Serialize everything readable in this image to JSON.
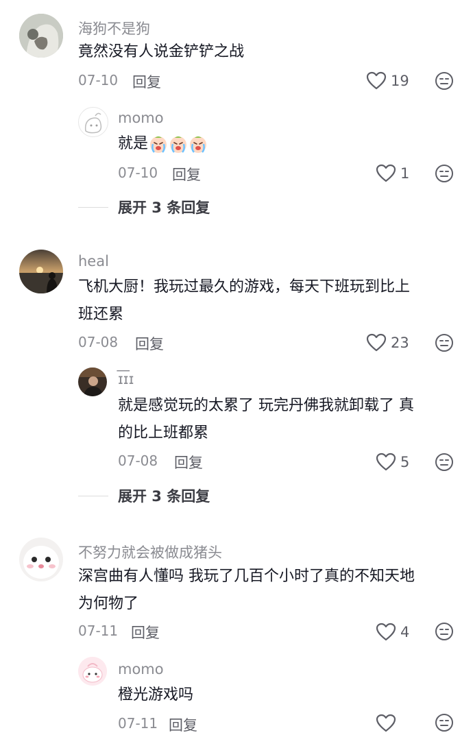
{
  "comments": [
    {
      "name": "海狗不是狗",
      "text_lines": [
        "竟然没有人说金铲铲之战"
      ],
      "date": "07-10",
      "reply_label": "回复",
      "likes": "19",
      "replies": [
        {
          "name": "momo",
          "text_lines": [
            "就是"
          ],
          "emojis": [
            "crying-face",
            "crying-face",
            "crying-face"
          ],
          "date": "07-10",
          "reply_label": "回复",
          "likes": "1"
        }
      ],
      "expand_label": "展开 3 条回复"
    },
    {
      "name": "heal",
      "text_lines": [
        "飞机大厨！我玩过最久的游戏，每天下班玩到比上",
        "班还累"
      ],
      "date": "07-08",
      "reply_label": "回复",
      "likes": "23",
      "replies": [
        {
          "name": "ɪ͞ɪɪ",
          "text_lines": [
            "就是感觉玩的太累了 玩完丹佛我就卸载了 真",
            "的比上班都累"
          ],
          "date": "07-08",
          "reply_label": "回复",
          "likes": "5"
        }
      ],
      "expand_label": "展开 3 条回复"
    },
    {
      "name": "不努力就会被做成猪头",
      "text_lines": [
        "深宫曲有人懂吗 我玩了几百个小时了真的不知天地",
        "为何物了"
      ],
      "date": "07-11",
      "reply_label": "回复",
      "likes": "4",
      "replies": [
        {
          "name": "momo",
          "text_lines": [
            "橙光游戏吗"
          ],
          "date": "07-11",
          "reply_label": "回复",
          "likes": ""
        }
      ]
    }
  ],
  "icons": {
    "like": "heart-outline-icon",
    "dislike": "neutral-face-icon",
    "emoji": "crying-face-emoji"
  },
  "colors": {
    "text_primary": "#161823",
    "text_secondary": "#8a8b91",
    "icon": "#5d5e66"
  }
}
